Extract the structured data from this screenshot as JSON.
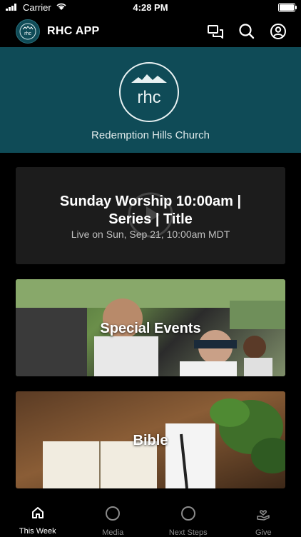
{
  "status_bar": {
    "carrier": "Carrier",
    "time": "4:28 PM"
  },
  "header": {
    "logo_text": "rhc",
    "title": "RHC APP"
  },
  "hero": {
    "logo_text": "rhc",
    "church_name": "Redemption Hills Church",
    "background": "#0f4b57"
  },
  "cards": [
    {
      "title": "Sunday Worship 10:00am | Series | Title",
      "subtitle": "Live on Sun, Sep 21, 10:00am MDT"
    },
    {
      "title": "Special Events"
    },
    {
      "title": "Bible"
    }
  ],
  "tabs": [
    {
      "label": "This Week",
      "icon": "home-icon",
      "active": true
    },
    {
      "label": "Media",
      "icon": "circle-icon",
      "active": false
    },
    {
      "label": "Next Steps",
      "icon": "circle-icon",
      "active": false
    },
    {
      "label": "Give",
      "icon": "give-hand-icon",
      "active": false
    }
  ]
}
